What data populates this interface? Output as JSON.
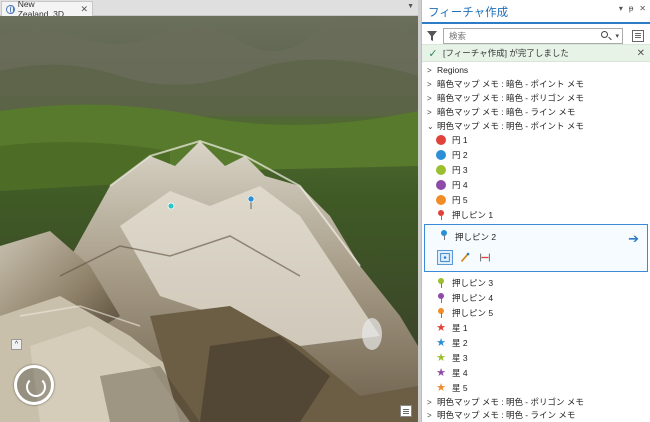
{
  "map_view": {
    "tab_title": "New Zealand_3D",
    "tab_close": "✕",
    "tab_dropdown": "▼",
    "nav_toggle": "^"
  },
  "pane": {
    "title": "フィーチャ作成",
    "controls": {
      "menu": "▾",
      "pin": "ᵽ",
      "close": "✕"
    },
    "search": {
      "placeholder": "検索",
      "dropdown": "▾"
    },
    "notice": {
      "check": "✓",
      "message": "[フィーチャ作成] が完了しました",
      "close": "✕"
    },
    "groups_top": [
      {
        "arrow": ">",
        "label": "Regions"
      },
      {
        "arrow": ">",
        "label": "暗色マップ メモ : 暗色 - ポイント メモ"
      },
      {
        "arrow": ">",
        "label": "暗色マップ メモ : 暗色 - ポリゴン メモ"
      },
      {
        "arrow": ">",
        "label": "暗色マップ メモ : 暗色 - ライン メモ"
      },
      {
        "arrow": "⌄",
        "label": "明色マップ メモ : 明色 - ポイント メモ"
      }
    ],
    "templates_a": [
      {
        "label": "円 1",
        "color": "#e0413b",
        "shape": "circle"
      },
      {
        "label": "円 2",
        "color": "#2a8fd6",
        "shape": "circle"
      },
      {
        "label": "円 3",
        "color": "#9bbf2e",
        "shape": "circle"
      },
      {
        "label": "円 4",
        "color": "#8e4aa8",
        "shape": "circle"
      },
      {
        "label": "円 5",
        "color": "#f28c28",
        "shape": "circle"
      },
      {
        "label": "押しピン 1",
        "color": "#e0413b",
        "shape": "pin"
      }
    ],
    "selected_template": {
      "label": "押しピン 2",
      "color": "#2a8fd6",
      "go": "➔"
    },
    "templates_b": [
      {
        "label": "押しピン 3",
        "color": "#9bbf2e",
        "shape": "pin"
      },
      {
        "label": "押しピン 4",
        "color": "#8e4aa8",
        "shape": "pin"
      },
      {
        "label": "押しピン 5",
        "color": "#f28c28",
        "shape": "pin"
      },
      {
        "label": "星 1",
        "color": "#e0413b",
        "shape": "star"
      },
      {
        "label": "星 2",
        "color": "#2a8fd6",
        "shape": "star"
      },
      {
        "label": "星 3",
        "color": "#9bbf2e",
        "shape": "star"
      },
      {
        "label": "星 4",
        "color": "#8e4aa8",
        "shape": "star"
      },
      {
        "label": "星 5",
        "color": "#f28c28",
        "shape": "star"
      }
    ],
    "groups_bottom": [
      {
        "arrow": ">",
        "label": "明色マップ メモ : 明色 - ポリゴン メモ"
      },
      {
        "arrow": ">",
        "label": "明色マップ メモ : 明色 - ライン メモ"
      }
    ],
    "colors": {
      "accent": "#2d7cc5",
      "notice_bg": "#e8f3e8",
      "check": "#2e8b57"
    }
  }
}
